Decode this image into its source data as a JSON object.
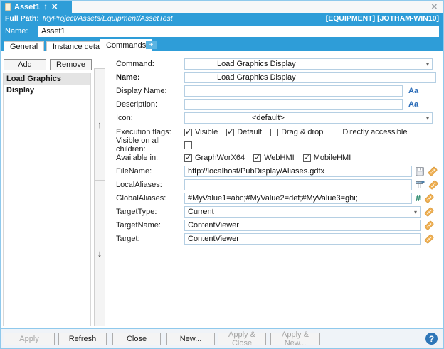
{
  "window": {
    "doc_tab": {
      "title": "Asset1",
      "up_glyph": "↑",
      "close_glyph": "✕"
    },
    "pane_close_glyph": "✕",
    "full_path": {
      "label": "Full Path:",
      "value": "MyProject/Assets/Equipment/AssetTest",
      "context": "[EQUIPMENT] [JOTHAM-WIN10]"
    },
    "name_bar": {
      "label": "Name:",
      "value": "Asset1"
    },
    "tabs": [
      {
        "label": "General"
      },
      {
        "label": "Instance details"
      },
      {
        "label": "Commands",
        "active": true
      },
      {
        "label": "+"
      }
    ]
  },
  "commands_panel": {
    "add_button": "Add",
    "remove_button": "Remove",
    "list": [
      {
        "label": "Load Graphics Display",
        "selected": true
      }
    ],
    "move_up_glyph": "↑",
    "move_down_glyph": "↓"
  },
  "form": {
    "command": {
      "label": "Command:",
      "value": "Load Graphics Display"
    },
    "name": {
      "label": "Name:",
      "value": "Load Graphics Display"
    },
    "display_name": {
      "label": "Display Name:",
      "value": ""
    },
    "description": {
      "label": "Description:",
      "value": ""
    },
    "icon": {
      "label": "Icon:",
      "value": "<default>"
    },
    "execution_flags": {
      "label": "Execution flags:",
      "options": [
        {
          "label": "Visible",
          "checked": true
        },
        {
          "label": "Default",
          "checked": true
        },
        {
          "label": "Drag & drop",
          "checked": false
        },
        {
          "label": "Directly accessible",
          "checked": false
        }
      ]
    },
    "visible_on_all_children": {
      "label": "Visible on all children:",
      "checked": false
    },
    "available_in": {
      "label": "Available in:",
      "options": [
        {
          "label": "GraphWorX64",
          "checked": true
        },
        {
          "label": "WebHMI",
          "checked": true
        },
        {
          "label": "MobileHMI",
          "checked": true
        }
      ]
    },
    "filename": {
      "label": "FileName:",
      "value": "http://localhost/PubDisplay/Aliases.gdfx"
    },
    "local_aliases": {
      "label": "LocalAliases:",
      "value": ""
    },
    "global_aliases": {
      "label": "GlobalAliases:",
      "value": "#MyValue1=abc;#MyValue2=def;#MyValue3=ghi;"
    },
    "target_type": {
      "label": "TargetType:",
      "value": "Current"
    },
    "target_name": {
      "label": "TargetName:",
      "value": "ContentViewer"
    },
    "target": {
      "label": "Target:",
      "value": "ContentViewer"
    }
  },
  "icons": {
    "hash_glyph": "#",
    "localize_glyph": "Aa"
  },
  "footer": {
    "buttons": [
      {
        "label": "Apply",
        "disabled": true
      },
      {
        "label": "Refresh",
        "disabled": false
      },
      {
        "label": "Close",
        "disabled": false
      },
      {
        "label": "New...",
        "disabled": false
      },
      {
        "label": "Apply & Close",
        "disabled": true
      },
      {
        "label": "Apply & New...",
        "disabled": true
      }
    ],
    "help_glyph": "?"
  },
  "colors": {
    "accent_blue": "#2E9DD8",
    "help_blue": "#2E76B8",
    "tag_orange": "#EFB054",
    "hash_green": "#2E8B6E",
    "localize_blue": "#2B6CB8"
  }
}
